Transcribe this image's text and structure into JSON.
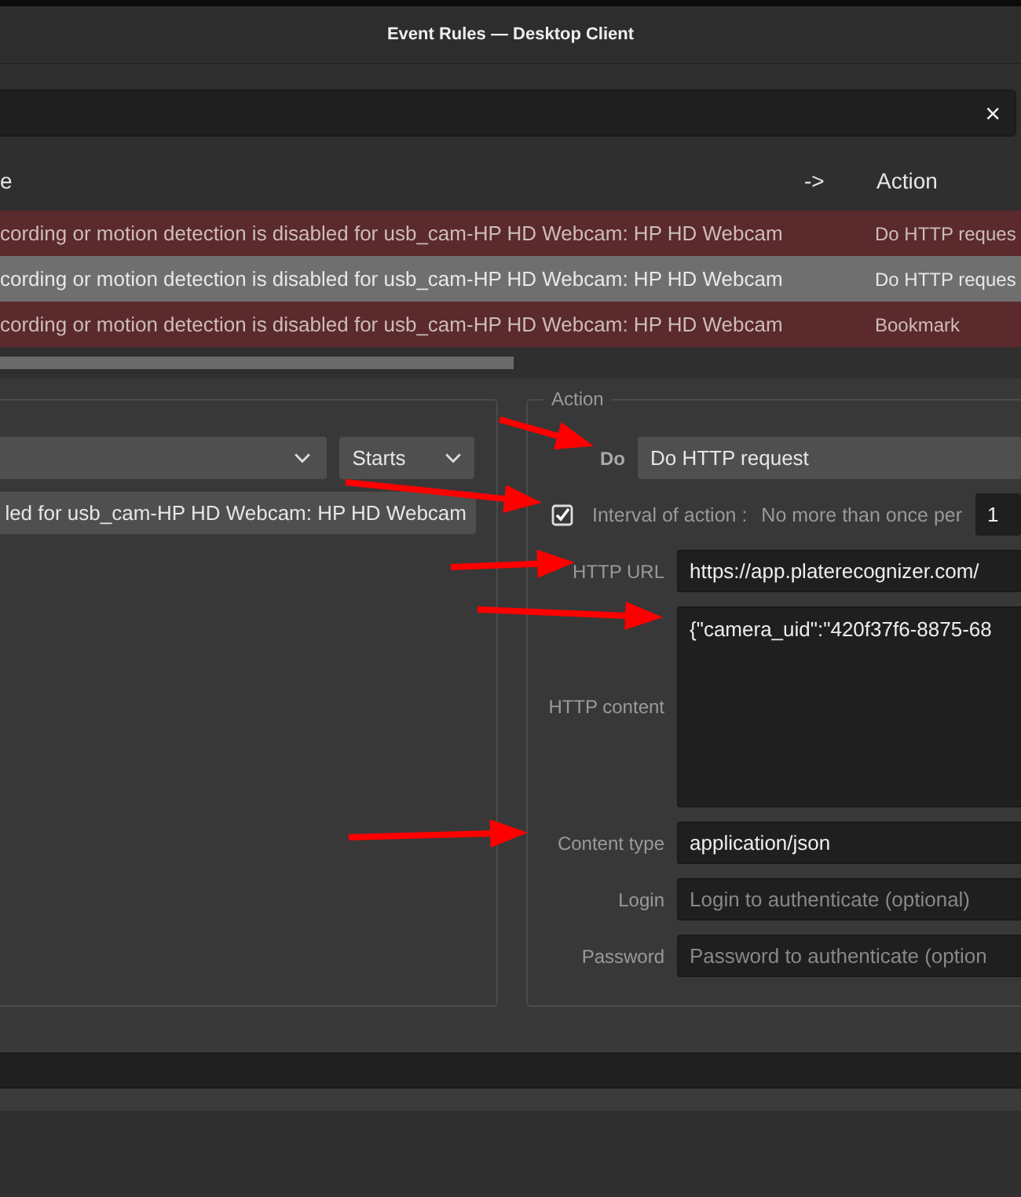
{
  "window": {
    "title": "Event Rules — Desktop Client"
  },
  "search": {
    "clear": "×"
  },
  "table": {
    "columns": [
      "e",
      "->",
      "Action"
    ],
    "rows": [
      {
        "event": "cording or motion detection is disabled for usb_cam-HP HD Webcam: HP HD Webcam",
        "action": "Do HTTP reques",
        "selected": false
      },
      {
        "event": "cording or motion detection is disabled for usb_cam-HP HD Webcam: HP HD Webcam",
        "action": "Do HTTP reques",
        "selected": true
      },
      {
        "event": "cording or motion detection is disabled for usb_cam-HP HD Webcam: HP HD Webcam",
        "action": "Bookmark",
        "selected": false
      }
    ]
  },
  "event_panel": {
    "state": "Starts",
    "event_text": "led for usb_cam-HP HD Webcam: HP HD Webcam"
  },
  "action_panel": {
    "title": "Action",
    "do_label": "Do",
    "do_value": "Do HTTP request",
    "interval": {
      "checked": true,
      "label": "Interval of action :",
      "text": "No more than once per",
      "value": "1"
    },
    "fields": [
      {
        "label": "HTTP URL",
        "kind": "input",
        "value": "https://app.platerecognizer.com/"
      },
      {
        "label": "HTTP content",
        "kind": "textarea",
        "value": "{\"camera_uid\":\"420f37f6-8875-68"
      },
      {
        "label": "Content type",
        "kind": "input",
        "value": "application/json"
      },
      {
        "label": "Login",
        "kind": "input",
        "placeholder": "Login to authenticate (optional)"
      },
      {
        "label": "Password",
        "kind": "input",
        "placeholder": "Password to authenticate (option"
      }
    ]
  }
}
